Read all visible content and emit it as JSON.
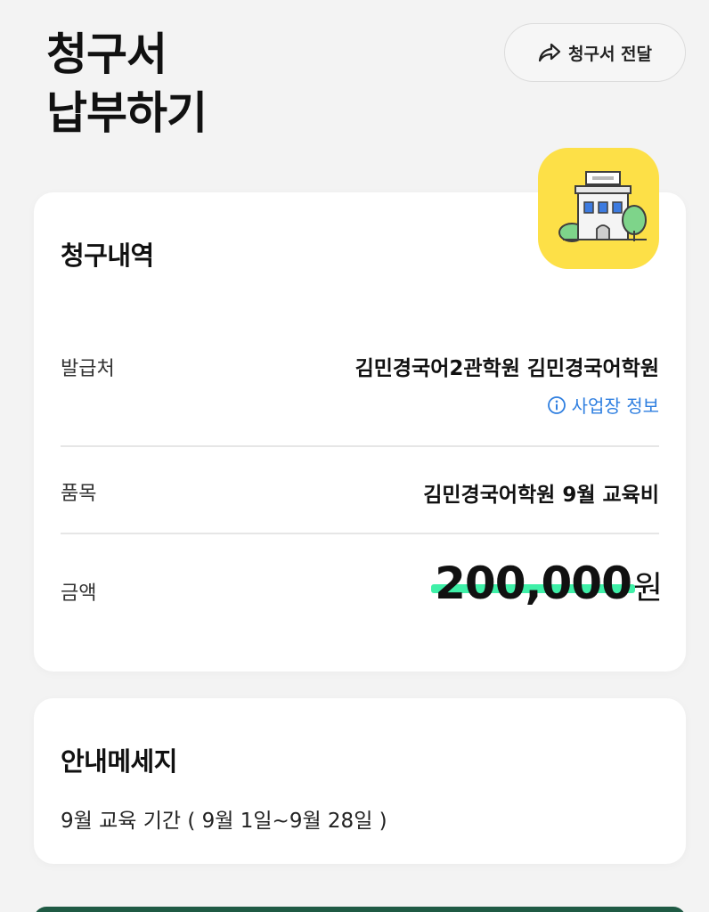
{
  "header": {
    "title_line1": "청구서",
    "title_line2": "납부하기",
    "forward_button_label": "청구서 전달",
    "forward_icon": "share-arrow-icon"
  },
  "billing": {
    "heading": "청구내역",
    "badge_icon": "building-icon",
    "issuer_label": "발급처",
    "issuer_value": "김민경국어2관학원 김민경국어학원",
    "business_info_label": "사업장 정보",
    "business_info_icon": "info-icon",
    "item_label": "품목",
    "item_value": "김민경국어학원 9월 교육비",
    "amount_label": "금액",
    "amount_value": "200,000",
    "amount_unit": "원"
  },
  "notice": {
    "heading": "안내메세지",
    "body": "9월 교육 기간 ( 9월 1일~9월 28일 )"
  },
  "colors": {
    "accent_highlight": "#3ff0a8",
    "badge_bg": "#fde047",
    "link": "#2f7fe0",
    "bottom_button": "#1f5a44"
  }
}
